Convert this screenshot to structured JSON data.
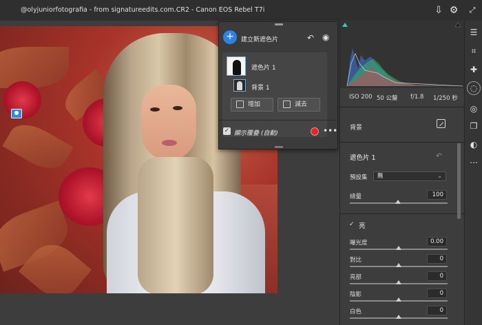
{
  "title_bar": {
    "title": "@olyjuniorfotografia  - from signatureedits.com.CR2  -  Canon EOS Rebel T7i"
  },
  "title_icons": {
    "export": "export-icon",
    "settings": "gear-icon",
    "expand": "expand-icon"
  },
  "mask_panel": {
    "new_mask_label": "建立新遮色片",
    "masks": [
      {
        "label": "遮色片 1",
        "selected": true
      },
      {
        "label": "背景 1",
        "selected": false
      }
    ],
    "add_label": "增加",
    "subtract_label": "減去",
    "overlay_label": "顯示覆疊 (自動)",
    "overlay_checked": true,
    "overlay_color": "#ff1d1d"
  },
  "histogram_info": {
    "iso": "ISO 200",
    "focal": "50 公釐",
    "aperture": "f/1.8",
    "shutter": "1/250 秒"
  },
  "background_label": "背景",
  "mask_section": {
    "title": "遮色片 1",
    "preset_label": "預設集",
    "preset_value": "無",
    "amount_label": "總量",
    "amount_value": "100",
    "amount_fraction": 1.0
  },
  "light_section": {
    "title": "亮",
    "controls": [
      {
        "label": "曝光度",
        "value": "0.00"
      },
      {
        "label": "對比",
        "value": "0"
      },
      {
        "label": "亮部",
        "value": "0"
      },
      {
        "label": "陰影",
        "value": "0"
      },
      {
        "label": "白色",
        "value": "0"
      }
    ]
  },
  "toolbar": [
    "adjust-sliders-icon",
    "crop-icon",
    "healing-icon",
    "mask-icon",
    "redeye-icon",
    "presets-icon",
    "snapshot-icon",
    "more-icon"
  ]
}
